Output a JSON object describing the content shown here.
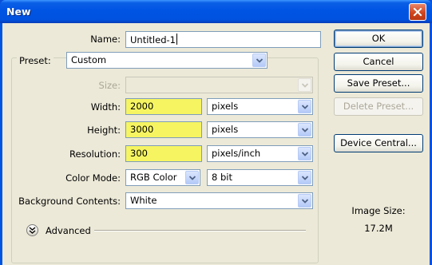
{
  "window": {
    "title": "New"
  },
  "name_field": {
    "label": "Name:",
    "value": "Untitled-1"
  },
  "preset": {
    "label": "Preset:",
    "value": "Custom"
  },
  "size": {
    "label": "Size:",
    "value": ""
  },
  "width": {
    "label": "Width:",
    "value": "2000",
    "unit": "pixels"
  },
  "height": {
    "label": "Height:",
    "value": "3000",
    "unit": "pixels"
  },
  "resolution": {
    "label": "Resolution:",
    "value": "300",
    "unit": "pixels/inch"
  },
  "color_mode": {
    "label": "Color Mode:",
    "value": "RGB Color",
    "bits": "8 bit"
  },
  "background": {
    "label": "Background Contents:",
    "value": "White"
  },
  "advanced": {
    "label": "Advanced"
  },
  "buttons": {
    "ok": "OK",
    "cancel": "Cancel",
    "save_preset": "Save Preset...",
    "delete_preset": "Delete Preset...",
    "device_central": "Device Central..."
  },
  "image_size": {
    "label": "Image Size:",
    "value": "17.2M"
  },
  "colors": {
    "highlight": "#f6f561",
    "title_bar": "#0054e3",
    "close_button": "#d0461f"
  }
}
